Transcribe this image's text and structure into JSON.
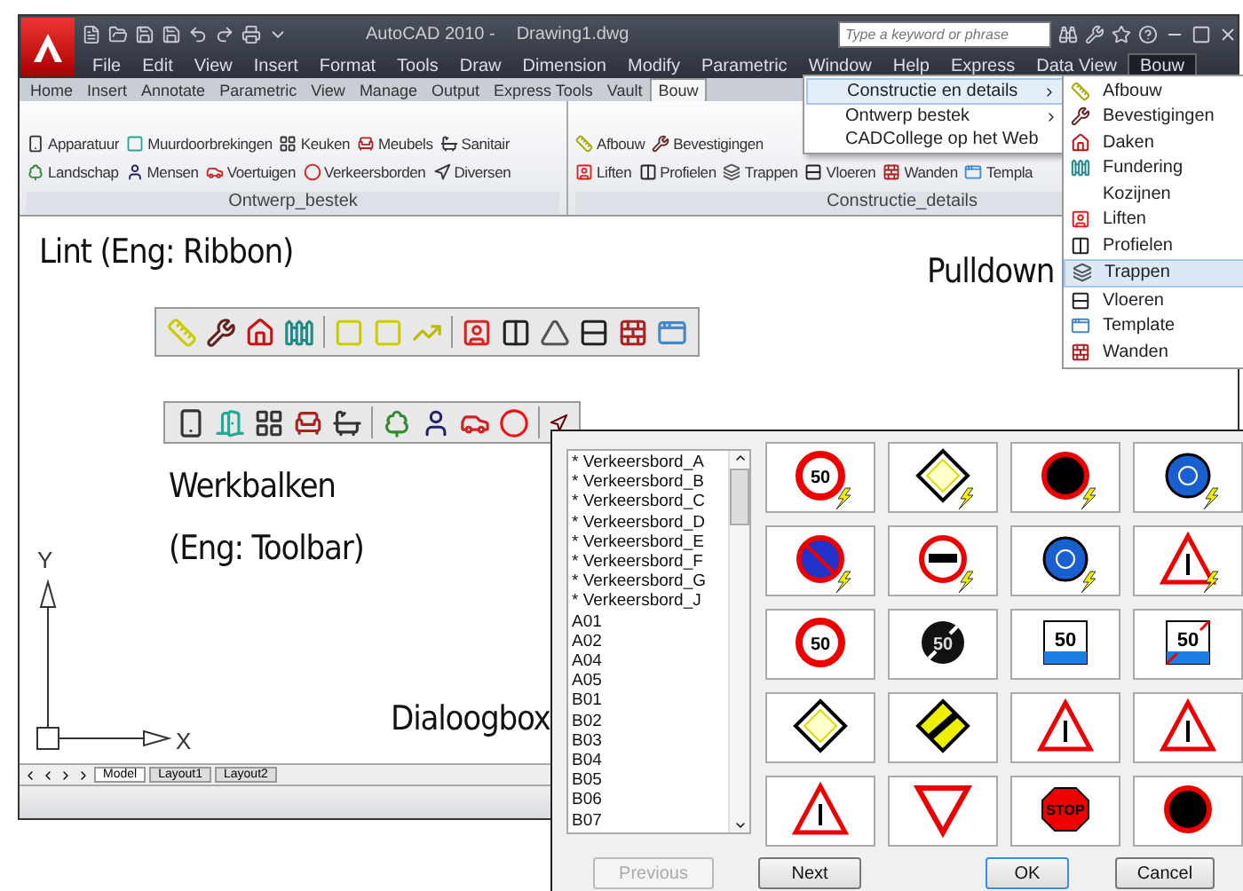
{
  "app": {
    "title": "AutoCAD 2010 -",
    "document": "Drawing1.dwg",
    "search": {
      "placeholder": "Type a keyword or phrase"
    }
  },
  "menu_bar": [
    {
      "label": "File",
      "selected": false
    },
    {
      "label": "Edit",
      "selected": false
    },
    {
      "label": "View",
      "selected": false
    },
    {
      "label": "Insert",
      "selected": false
    },
    {
      "label": "Format",
      "selected": false
    },
    {
      "label": "Tools",
      "selected": false
    },
    {
      "label": "Draw",
      "selected": false
    },
    {
      "label": "Dimension",
      "selected": false
    },
    {
      "label": "Modify",
      "selected": false
    },
    {
      "label": "Parametric",
      "selected": false
    },
    {
      "label": "Window",
      "selected": false
    },
    {
      "label": "Help",
      "selected": false
    },
    {
      "label": "Express",
      "selected": false
    },
    {
      "label": "Data View",
      "selected": false
    },
    {
      "label": "Bouw",
      "selected": true
    }
  ],
  "ribbon_tabs": [
    {
      "label": "Home",
      "selected": false
    },
    {
      "label": "Insert",
      "selected": false
    },
    {
      "label": "Annotate",
      "selected": false
    },
    {
      "label": "Parametric",
      "selected": false
    },
    {
      "label": "View",
      "selected": false
    },
    {
      "label": "Manage",
      "selected": false
    },
    {
      "label": "Output",
      "selected": false
    },
    {
      "label": "Express Tools",
      "selected": false
    },
    {
      "label": "Vault",
      "selected": false
    },
    {
      "label": "Bouw",
      "selected": true
    }
  ],
  "ribbon_panels": [
    {
      "title": "Ontwerp_bestek",
      "top_line": [
        "Apparatuur",
        "Muurdoorbrekingen",
        "Keuken",
        "Meubels",
        "Sanitair"
      ],
      "bottom_line": [
        "Landschap",
        "Mensen",
        "Voertuigen",
        "Verkeersborden",
        "Diversen"
      ]
    },
    {
      "title": "Constructie_details",
      "top_line": [
        "Afbouw",
        "Bevestigingen"
      ],
      "bottom_line": [
        "Liften",
        "Profielen",
        "Trappen",
        "Vloeren",
        "Wanden",
        "Templa"
      ]
    }
  ],
  "pulldown": {
    "items": [
      {
        "label": "Constructie en details",
        "has_submenu": true,
        "selected": true
      },
      {
        "label": "Ontwerp bestek",
        "has_submenu": true,
        "selected": false
      },
      {
        "label": "CADCollege op het Web",
        "has_submenu": false,
        "selected": false
      }
    ],
    "submenu": [
      {
        "label": "Afbouw",
        "selected": false
      },
      {
        "label": "Bevestigingen",
        "selected": false
      },
      {
        "label": "Daken",
        "selected": false
      },
      {
        "label": "Fundering",
        "selected": false
      },
      {
        "label": "Kozijnen",
        "selected": false
      },
      {
        "label": "Liften",
        "selected": false
      },
      {
        "label": "Profielen",
        "selected": false
      },
      {
        "label": "Trappen",
        "selected": true
      },
      {
        "label": "Vloeren",
        "selected": false
      },
      {
        "label": "Template",
        "selected": false
      },
      {
        "label": "Wanden",
        "selected": false
      }
    ]
  },
  "annotations": [
    {
      "text": "Lint (Eng: Ribbon)",
      "kind": "lint"
    },
    {
      "text": "Pulldown",
      "kind": "pulldown"
    },
    {
      "text": "Werkbalken",
      "kind": "werkbalken"
    },
    {
      "text": "(Eng: Toolbar)",
      "kind": "toolbar"
    },
    {
      "text": "Dialoogbox",
      "kind": "dialoog"
    }
  ],
  "ucs": {
    "x_label": "X",
    "y_label": "Y"
  },
  "layout_tabs": [
    {
      "label": "Model",
      "selected": true
    },
    {
      "label": "Layout1",
      "selected": false
    },
    {
      "label": "Layout2",
      "selected": false
    }
  ],
  "dialog": {
    "list": [
      "* Verkeersbord_A",
      "* Verkeersbord_B",
      "* Verkeersbord_C",
      "* Verkeersbord_D",
      "* Verkeersbord_E",
      "* Verkeersbord_F",
      "* Verkeersbord_G",
      "* Verkeersbord_J",
      "A01",
      "A02",
      "A04",
      "A05",
      "B01",
      "B02",
      "B03",
      "B04",
      "B05",
      "B06",
      "B07"
    ],
    "signs": [
      {
        "kind": "speed",
        "text": "50",
        "bolt": true
      },
      {
        "kind": "diamond",
        "bolt": true
      },
      {
        "kind": "ring",
        "bolt": true
      },
      {
        "kind": "blue",
        "bolt": true
      },
      {
        "kind": "noparking",
        "bolt": true
      },
      {
        "kind": "overtake",
        "bolt": true
      },
      {
        "kind": "blue",
        "bolt": true
      },
      {
        "kind": "triangle",
        "bolt": true
      },
      {
        "kind": "speed",
        "text": "50",
        "bolt": false
      },
      {
        "kind": "endspeed",
        "text": "50",
        "bolt": false
      },
      {
        "kind": "zone",
        "text": "50",
        "bolt": false
      },
      {
        "kind": "endzone",
        "text": "50",
        "bolt": false
      },
      {
        "kind": "diamond",
        "bolt": false
      },
      {
        "kind": "enddiamond",
        "bolt": false
      },
      {
        "kind": "triangle",
        "bolt": false
      },
      {
        "kind": "triangle",
        "bolt": false
      },
      {
        "kind": "triangle",
        "bolt": false
      },
      {
        "kind": "yield",
        "bolt": false
      },
      {
        "kind": "stop",
        "text": "STOP",
        "bolt": false
      },
      {
        "kind": "ring",
        "bolt": false
      }
    ],
    "buttons": [
      {
        "label": "Previous",
        "disabled": true,
        "default": false
      },
      {
        "label": "Next",
        "disabled": false,
        "default": false
      },
      {
        "label": "OK",
        "disabled": false,
        "default": true
      },
      {
        "label": "Cancel",
        "disabled": false,
        "default": false
      }
    ]
  }
}
